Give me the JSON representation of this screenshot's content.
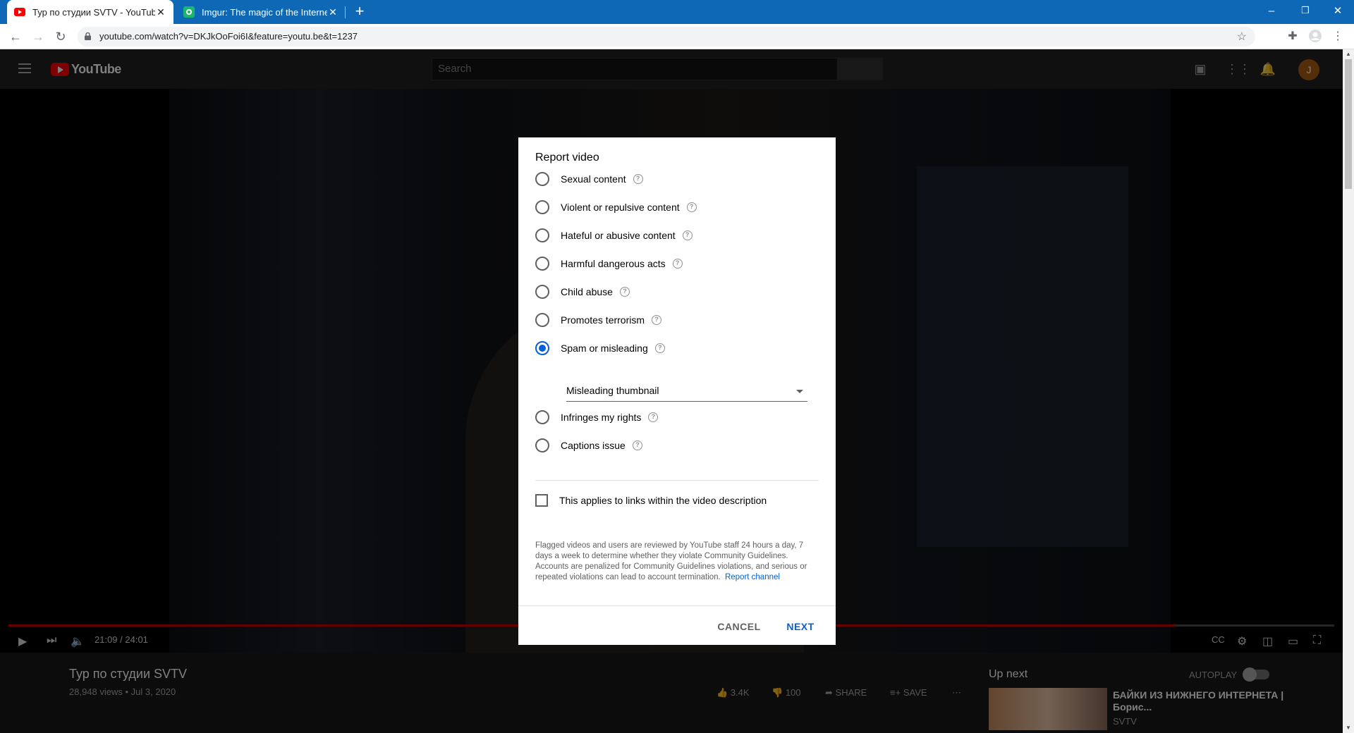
{
  "browser": {
    "tabs": [
      {
        "title": "Тур по студии SVTV - YouTube",
        "active": true
      },
      {
        "title": "Imgur: The magic of the Internet",
        "active": false
      }
    ],
    "new_tab_label": "+",
    "window_controls": {
      "minimize": "–",
      "restore": "❐",
      "close": "✕"
    },
    "url": "youtube.com/watch?v=DKJkOoFoi6I&feature=youtu.be&t=1237"
  },
  "youtube": {
    "logo_text": "YouTube",
    "search_placeholder": "Search",
    "avatar_letter": "J",
    "player": {
      "time": "21:09 / 24:01",
      "progress_fraction": 0.88
    },
    "video": {
      "title": "Тур по студии SVTV",
      "meta": "28,948 views • Jul 3, 2020",
      "likes": "3.4K",
      "dislikes": "100",
      "share_label": "SHARE",
      "save_label": "SAVE"
    },
    "sidebar": {
      "up_next": "Up next",
      "autoplay": "AUTOPLAY",
      "recommendation": {
        "title": "БАЙКИ ИЗ НИЖНЕГО ИНТЕРНЕТА | Борис...",
        "channel": "SVTV"
      }
    }
  },
  "dialog": {
    "title": "Report video",
    "options": [
      {
        "label": "Sexual content",
        "checked": false
      },
      {
        "label": "Violent or repulsive content",
        "checked": false
      },
      {
        "label": "Hateful or abusive content",
        "checked": false
      },
      {
        "label": "Harmful dangerous acts",
        "checked": false
      },
      {
        "label": "Child abuse",
        "checked": false
      },
      {
        "label": "Promotes terrorism",
        "checked": false
      },
      {
        "label": "Spam or misleading",
        "checked": true
      },
      {
        "label": "Infringes my rights",
        "checked": false
      },
      {
        "label": "Captions issue",
        "checked": false
      }
    ],
    "help_glyph": "?",
    "subreason_selected": "Misleading thumbnail",
    "checkbox_label": "This applies to links within the video description",
    "checkbox_checked": false,
    "fineprint": "Flagged videos and users are reviewed by YouTube staff 24 hours a day, 7 days a week to determine whether they violate Community Guidelines. Accounts are penalized for Community Guidelines violations, and serious or repeated violations can lead to account termination.",
    "report_channel_link": "Report channel",
    "cancel_label": "CANCEL",
    "next_label": "NEXT"
  },
  "colors": {
    "chrome_tabbar": "#0e68b6",
    "accent_blue": "#065fd4",
    "yt_red": "#ff0000"
  }
}
